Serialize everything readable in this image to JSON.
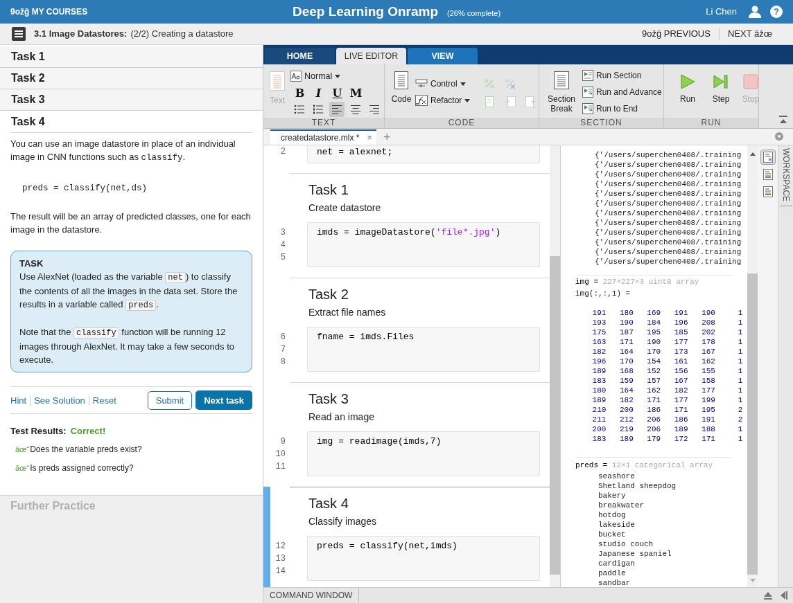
{
  "header": {
    "courses_link": "9ožĝ MY COURSES",
    "title": "Deep Learning Onramp",
    "progress": "(26% complete)",
    "user_name": "Li Chen",
    "help": "?"
  },
  "subheader": {
    "section": "3.1 Image Datastores:",
    "subtitle": "(2/2) Creating a datastore",
    "previous": "9ožĝ PREVIOUS",
    "next": "NEXT âžœ"
  },
  "tasks": [
    {
      "label": "Task 1",
      "expanded": false
    },
    {
      "label": "Task 2",
      "expanded": false
    },
    {
      "label": "Task 3",
      "expanded": false
    },
    {
      "label": "Task 4",
      "expanded": true
    }
  ],
  "task_body": {
    "intro": [
      {
        "text": "You can use an image datastore in place of an individual image in CNN functions such as ",
        "kind": "plain"
      },
      {
        "text": "classify",
        "kind": "code"
      },
      {
        "text": ".",
        "kind": "plain"
      }
    ],
    "example": "preds = classify(net,ds)",
    "result": "The result will be an array of predicted classes, one for each image in the datastore.",
    "task_box": {
      "title": "TASK",
      "paragraphs": [
        [
          {
            "text": "Use AlexNet (loaded as the variable ",
            "kind": "plain"
          },
          {
            "text": "net",
            "kind": "code"
          },
          {
            "text": ") to classify the contents of all the images in the data set. Store the results in a variable called ",
            "kind": "plain"
          },
          {
            "text": "preds",
            "kind": "code"
          },
          {
            "text": ".",
            "kind": "plain"
          }
        ],
        [
          {
            "text": "Note that the ",
            "kind": "plain"
          },
          {
            "text": "classify",
            "kind": "code"
          },
          {
            "text": " function will be running 12 images through AlexNet. It may take a few seconds to execute.",
            "kind": "plain"
          }
        ]
      ]
    }
  },
  "actions": {
    "links": [
      "Hint",
      "See Solution",
      "Reset"
    ],
    "submit": "Submit",
    "next": "Next task"
  },
  "test_results": {
    "label": "Test Results:",
    "status": "Correct!",
    "checks": [
      {
        "mark": "âœ“",
        "text": "Does the variable preds exist?"
      },
      {
        "mark": "âœ“",
        "text": "Is preds assigned correctly?"
      }
    ]
  },
  "further_practice": "Further Practice",
  "matlab": {
    "tabs": [
      {
        "label": "HOME",
        "selected": false
      },
      {
        "label": "LIVE EDITOR",
        "selected": true
      },
      {
        "label": "VIEW",
        "selected": false,
        "hover": true
      }
    ],
    "toolstrip": [
      {
        "label": "TEXT",
        "big": [
          {
            "label": "Text",
            "disabled": true
          }
        ],
        "style_dropdown": "Normal",
        "format_buttons": [
          "B",
          "I",
          "U",
          "M"
        ]
      },
      {
        "label": "CODE",
        "big": [
          {
            "label": "Code",
            "disabled": false
          }
        ],
        "small": [
          "Control",
          "Refactor"
        ]
      },
      {
        "label": "SECTION",
        "big": [
          {
            "label": "Section Break",
            "disabled": false
          }
        ],
        "small": [
          "Run Section",
          "Run and Advance",
          "Run to End"
        ]
      },
      {
        "label": "RUN",
        "big": [
          {
            "label": "Run",
            "disabled": false
          },
          {
            "label": "Step",
            "disabled": false
          },
          {
            "label": "Stop",
            "disabled": true
          }
        ]
      }
    ],
    "doc_tabs": [
      {
        "label": "createdatastore.mlx *",
        "selected": true,
        "close": "×"
      }
    ],
    "add_tab": "+",
    "sections": [
      {
        "active": false,
        "lines": [
          {
            "number": "2",
            "code": [
              {
                "text": "net = alexnet;",
                "kind": "plain"
              }
            ]
          }
        ]
      },
      {
        "active": false,
        "heading": "Task 1",
        "text": "Create datastore",
        "lines": [
          {
            "number": "3",
            "code": [
              {
                "text": "imds = imageDatastore(",
                "kind": "plain"
              },
              {
                "text": "'file*.jpg'",
                "kind": "string"
              },
              {
                "text": ")",
                "kind": "plain"
              }
            ]
          },
          {
            "number": "4"
          },
          {
            "number": "5"
          }
        ]
      },
      {
        "active": false,
        "heading": "Task 2",
        "text": "Extract file names",
        "lines": [
          {
            "number": "6",
            "code": [
              {
                "text": "fname = imds.Files",
                "kind": "plain"
              }
            ]
          },
          {
            "number": "7"
          },
          {
            "number": "8"
          }
        ]
      },
      {
        "active": false,
        "heading": "Task 3",
        "text": "Read an image",
        "lines": [
          {
            "number": "9",
            "code": [
              {
                "text": "img = readimage(imds,7)",
                "kind": "plain"
              }
            ]
          },
          {
            "number": "10"
          },
          {
            "number": "11"
          }
        ]
      },
      {
        "active": true,
        "heading": "Task 4",
        "text": "Classify images",
        "lines": [
          {
            "number": "12",
            "code": [
              {
                "text": "preds = classify(net,imds)",
                "kind": "plain"
              }
            ]
          },
          {
            "number": "13"
          },
          {
            "number": "14"
          }
        ]
      }
    ],
    "output": [
      {
        "kind": "lines",
        "lines": [
          "{'/users/superchen0408/.training",
          "{'/users/superchen0408/.training",
          "{'/users/superchen0408/.training",
          "{'/users/superchen0408/.training",
          "{'/users/superchen0408/.training",
          "{'/users/superchen0408/.training",
          "{'/users/superchen0408/.training",
          "{'/users/superchen0408/.training",
          "{'/users/superchen0408/.training",
          "{'/users/superchen0408/.training",
          "{'/users/superchen0408/.training",
          "{'/users/superchen0408/.training"
        ]
      },
      {
        "kind": "matrix",
        "label": "img =",
        "info": "227×227×3 uint8 array",
        "caption": "img(:,:,1) =",
        "rows": [
          [
            "191",
            "180",
            "169",
            "191",
            "190",
            "1"
          ],
          [
            "193",
            "190",
            "184",
            "196",
            "208",
            "1"
          ],
          [
            "175",
            "187",
            "195",
            "185",
            "202",
            "1"
          ],
          [
            "163",
            "171",
            "190",
            "177",
            "178",
            "1"
          ],
          [
            "182",
            "164",
            "170",
            "173",
            "167",
            "1"
          ],
          [
            "196",
            "170",
            "154",
            "161",
            "162",
            "1"
          ],
          [
            "189",
            "168",
            "152",
            "156",
            "155",
            "1"
          ],
          [
            "183",
            "159",
            "157",
            "167",
            "158",
            "1"
          ],
          [
            "180",
            "164",
            "162",
            "182",
            "177",
            "1"
          ],
          [
            "189",
            "182",
            "171",
            "177",
            "199",
            "1"
          ],
          [
            "210",
            "200",
            "186",
            "171",
            "195",
            "2"
          ],
          [
            "211",
            "212",
            "206",
            "186",
            "191",
            "2"
          ],
          [
            "200",
            "219",
            "206",
            "189",
            "188",
            "1"
          ],
          [
            "183",
            "189",
            "179",
            "172",
            "171",
            "1"
          ]
        ]
      },
      {
        "kind": "list",
        "label": "preds =",
        "info": "12×1 categorical array",
        "items": [
          "seashore",
          "Shetland sheepdog",
          "bakery",
          "breakwater",
          "hotdog",
          "lakeside",
          "bucket",
          "studio couch",
          "Japanese spaniel",
          "cardigan",
          "paddle",
          "sandbar"
        ]
      }
    ],
    "side_tools": [
      {
        "selected": true
      },
      {
        "selected": false
      },
      {
        "selected": false
      }
    ],
    "workspace_label": "WORKSPACE",
    "command_window": "COMMAND WINDOW"
  }
}
